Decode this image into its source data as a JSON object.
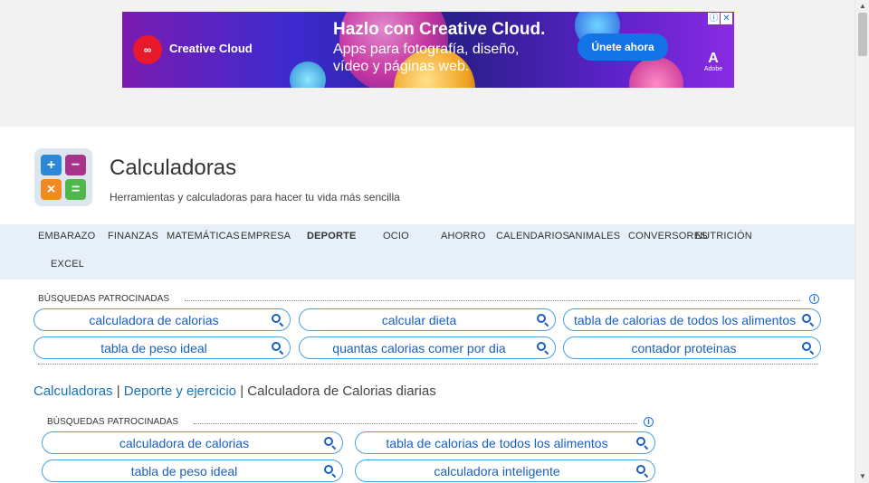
{
  "ad": {
    "brand": "Creative Cloud",
    "headline": "Hazlo con Creative Cloud.",
    "subline": "Apps para fotografía, diseño, vídeo y páginas web.",
    "cta": "Únete ahora",
    "vendor": "Adobe"
  },
  "site": {
    "title": "Calculadoras",
    "tagline": "Herramientas y calculadoras para hacer tu vida más sencilla"
  },
  "nav": {
    "items": [
      "EMBARAZO",
      "FINANZAS",
      "MATEMÁTICAS",
      "EMPRESA",
      "DEPORTE",
      "OCIO",
      "AHORRO",
      "CALENDARIOS",
      "ANIMALES",
      "CONVERSORES",
      "NUTRICIÓN",
      "EXCEL"
    ],
    "active": "DEPORTE"
  },
  "sponsored_top": {
    "label": "BÚSQUEDAS PATROCINADAS",
    "pills": [
      "calculadora de calorias",
      "calcular dieta",
      "tabla de calorias de todos los alimentos",
      "tabla de peso ideal",
      "quantas calorias comer por dia",
      "contador proteinas"
    ]
  },
  "breadcrumb": {
    "home": "Calculadoras",
    "sep": "|",
    "section": "Deporte y ejercicio",
    "current": "Calculadora de Calorias diarias"
  },
  "sponsored_bottom": {
    "label": "BÚSQUEDAS PATROCINADAS",
    "pills": [
      "calculadora de calorias",
      "tabla de calorias de todos los alimentos",
      "tabla de peso ideal",
      "calculadora inteligente"
    ]
  },
  "colors": {
    "accent": "#1a5fbf",
    "pill_border": "#4aa0dc",
    "nav_bg": "#e7f0f8"
  }
}
